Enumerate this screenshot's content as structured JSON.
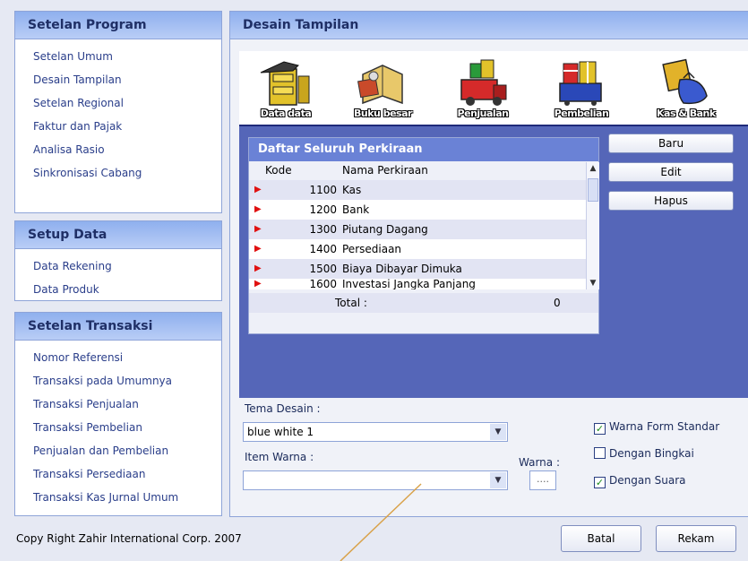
{
  "sidebar": {
    "sections": [
      {
        "title": "Setelan Program",
        "items": [
          "Setelan Umum",
          "Desain Tampilan",
          "Setelan Regional",
          "Faktur dan Pajak",
          "Analisa Rasio",
          "Sinkronisasi Cabang"
        ]
      },
      {
        "title": "Setup Data",
        "items": [
          "Data Rekening",
          "Data Produk"
        ]
      },
      {
        "title": "Setelan Transaksi",
        "items": [
          "Nomor Referensi",
          "Transaksi pada Umumnya",
          "Transaksi Penjualan",
          "Transaksi Pembelian",
          "Penjualan dan Pembelian",
          "Transaksi Persediaan",
          "Transaksi Kas Jurnal Umum"
        ]
      }
    ]
  },
  "main": {
    "title": "Desain Tampilan",
    "toolbar": [
      "Data data",
      "Buku besar",
      "Penjualan",
      "Pembelian",
      "Kas & Bank"
    ],
    "grid": {
      "title": "Daftar Seluruh Perkiraan",
      "columns": [
        "Kode",
        "Nama Perkiraan"
      ],
      "rows": [
        {
          "code": "1100",
          "name": "Kas"
        },
        {
          "code": "1200",
          "name": "Bank"
        },
        {
          "code": "1300",
          "name": "Piutang Dagang"
        },
        {
          "code": "1400",
          "name": "Persediaan"
        },
        {
          "code": "1500",
          "name": "Biaya Dibayar Dimuka"
        },
        {
          "code": "1600",
          "name": "Investasi Jangka Panjang"
        }
      ],
      "total_label": "Total :",
      "total_value": "0"
    },
    "buttons": {
      "baru": "Baru",
      "edit": "Edit",
      "hapus": "Hapus"
    },
    "tema_desain_label": "Tema Desain :",
    "tema_desain_value": "blue white 1",
    "item_warna_label": "Item Warna :",
    "item_warna_value": "",
    "warna_label": "Warna :",
    "warna_button": "....",
    "checkboxes": [
      {
        "label": "Warna Form Standar",
        "checked": true
      },
      {
        "label": "Dengan Bingkai",
        "checked": false
      },
      {
        "label": "Dengan Suara",
        "checked": true
      }
    ]
  },
  "footer": {
    "copyright": "Copy Right Zahir International Corp. 2007",
    "batal": "Batal",
    "rekam": "Rekam"
  }
}
